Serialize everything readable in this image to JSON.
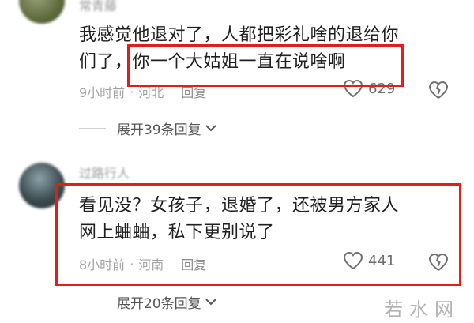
{
  "comments": [
    {
      "username": "常青藤",
      "text_line1": "我感觉他退对了，人都把彩礼啥的退给你",
      "text_line2": "们了，你一个大姑姐一直在说啥啊",
      "time": "9小时前",
      "separator": "·",
      "location": "河北",
      "reply_label": "回复",
      "likes": "629",
      "expand_label": "展开39条回复"
    },
    {
      "username": "过路行人",
      "text_line1": "看见没？女孩子，退婚了，还被男方家人",
      "text_line2": "网上蛐蛐，私下更别说了",
      "time": "8小时前",
      "separator": "·",
      "location": "河南",
      "reply_label": "回复",
      "likes": "441",
      "expand_label": "展开20条回复"
    }
  ],
  "watermark": "若水网",
  "colors": {
    "highlight": "#e21d1d",
    "meta": "#a3a3a3",
    "text": "#1f1f1f"
  },
  "icons": {
    "like": "heart-outline-icon",
    "dislike": "broken-heart-icon",
    "expand": "chevron-down-icon"
  }
}
